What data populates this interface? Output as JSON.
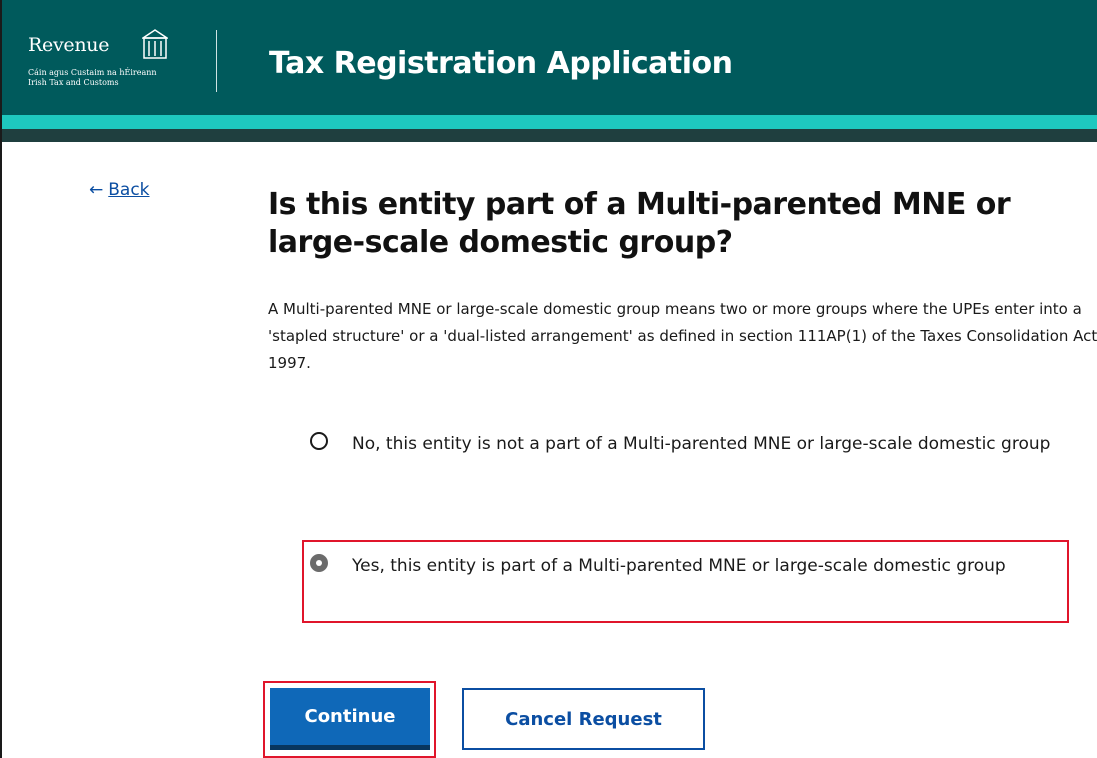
{
  "header": {
    "logo": {
      "name": "Revenue",
      "subtitle_irish": "Cáin agus Custaim na hÉireann",
      "subtitle_english": "Irish Tax and Customs"
    },
    "title": "Tax Registration Application"
  },
  "navigation": {
    "back_label": "Back",
    "back_icon": "left-arrow-icon"
  },
  "question": {
    "heading": "Is this entity part of a Multi-parented MNE or large-scale domestic group?",
    "description": "A Multi-parented MNE or large-scale domestic group means two or more groups where the UPEs enter into a 'stapled structure' or a 'dual-listed arrangement' as defined in section 111AP(1) of the Taxes Consolidation Act 1997."
  },
  "options": [
    {
      "label": "No, this entity is not a part of a Multi-parented MNE or large-scale domestic group",
      "selected": false
    },
    {
      "label": "Yes, this entity is part of a Multi-parented MNE or large-scale domestic group",
      "selected": true
    }
  ],
  "buttons": {
    "continue": "Continue",
    "cancel": "Cancel Request"
  },
  "colors": {
    "header_bg": "#005a5c",
    "header_stripe": "#1ec8bf",
    "primary_button": "#0f68b8",
    "link": "#0b4ea2",
    "highlight": "#e0152b"
  }
}
